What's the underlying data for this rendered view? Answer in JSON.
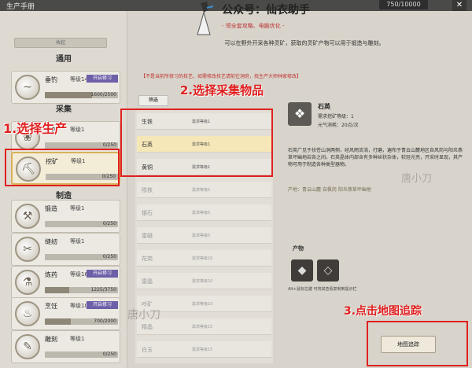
{
  "window": {
    "title": "生产手册",
    "currency": "750/10000",
    "close": "✕"
  },
  "watermark": {
    "account": "公众号：仙衣助手",
    "sub": "- 领全套攻略、电脑优化 -",
    "mark1": "唐小刀",
    "mark2": "唐小刀"
  },
  "collapse": "收起",
  "sections": {
    "general": "通用",
    "gather": "采集",
    "craft": "制造"
  },
  "skills": [
    {
      "name": "垂钓",
      "level": "等级14",
      "badge": "开启修习",
      "progress": "1600/2500",
      "pct": 0.64,
      "glyph": "~"
    },
    {
      "name": "采药",
      "level": "等级1",
      "badge": "",
      "progress": "0/250",
      "pct": 0,
      "glyph": "❀"
    },
    {
      "name": "挖矿",
      "level": "等级1",
      "badge": "",
      "progress": "0/250",
      "pct": 0,
      "glyph": "⛏"
    },
    {
      "name": "锻造",
      "level": "等级1",
      "badge": "",
      "progress": "0/250",
      "pct": 0,
      "glyph": "⚒"
    },
    {
      "name": "缝纫",
      "level": "等级1",
      "badge": "",
      "progress": "0/250",
      "pct": 0,
      "glyph": "✂"
    },
    {
      "name": "炼药",
      "level": "等级16",
      "badge": "开启修习",
      "progress": "1225/3750",
      "pct": 0.33,
      "glyph": "⚗"
    },
    {
      "name": "烹饪",
      "level": "等级10",
      "badge": "开启修习",
      "progress": "700/2000",
      "pct": 0.35,
      "glyph": "♨"
    },
    {
      "name": "雕刻",
      "level": "等级1",
      "badge": "",
      "progress": "0/250",
      "pct": 0,
      "glyph": "✎"
    }
  ],
  "annotations": {
    "a1": "1.选择生产",
    "a2": "2.选择采集物品",
    "a3": "3.点击地图追踪"
  },
  "main": {
    "description": "可以在野外开采各种灵矿，获取的灵矿产物可以用于锻造与雕刻。",
    "notice": "【不是当前所修习的技艺，如需修改技艺请前往洞府，找生产大师林家修改】",
    "filter": "筛选"
  },
  "materials": [
    {
      "name": "生铁",
      "req": "需求等级1"
    },
    {
      "name": "石英",
      "req": "需求等级1"
    },
    {
      "name": "黄铜",
      "req": "需求等级1"
    },
    {
      "name": "陨铁",
      "req": "需求等级5"
    },
    {
      "name": "银石",
      "req": "需求等级5"
    },
    {
      "name": "雷磁",
      "req": "需求等级5"
    },
    {
      "name": "花岗",
      "req": "需求等级10"
    },
    {
      "name": "雷晶",
      "req": "需求等级10"
    },
    {
      "name": "呤矿",
      "req": "需求等级10"
    },
    {
      "name": "精晶",
      "req": "需求等级15"
    },
    {
      "name": "白玉",
      "req": "需求等级15"
    }
  ],
  "detail": {
    "name": "石英",
    "req": "需求挖矿等级：1",
    "cost": "元气消耗：20点/次",
    "text": "石英广见于扶苍山洞两侧，经风雨流淌，打磨，遍布于青云山麓地区自风岗与阳炎燕草坪幽地岩各之间。石英晶体内部含有多种丝状杂体，较轻光亮，开采时显现，其产物可用于制造各种类型器物。",
    "origin": "产地：青云山麓    自枫岗  阳炎燕草坪幽地",
    "products_label": "产物",
    "hint": "Alt+鼠标左键 可将其查看复制到提示栏",
    "track": "地图追踪"
  }
}
